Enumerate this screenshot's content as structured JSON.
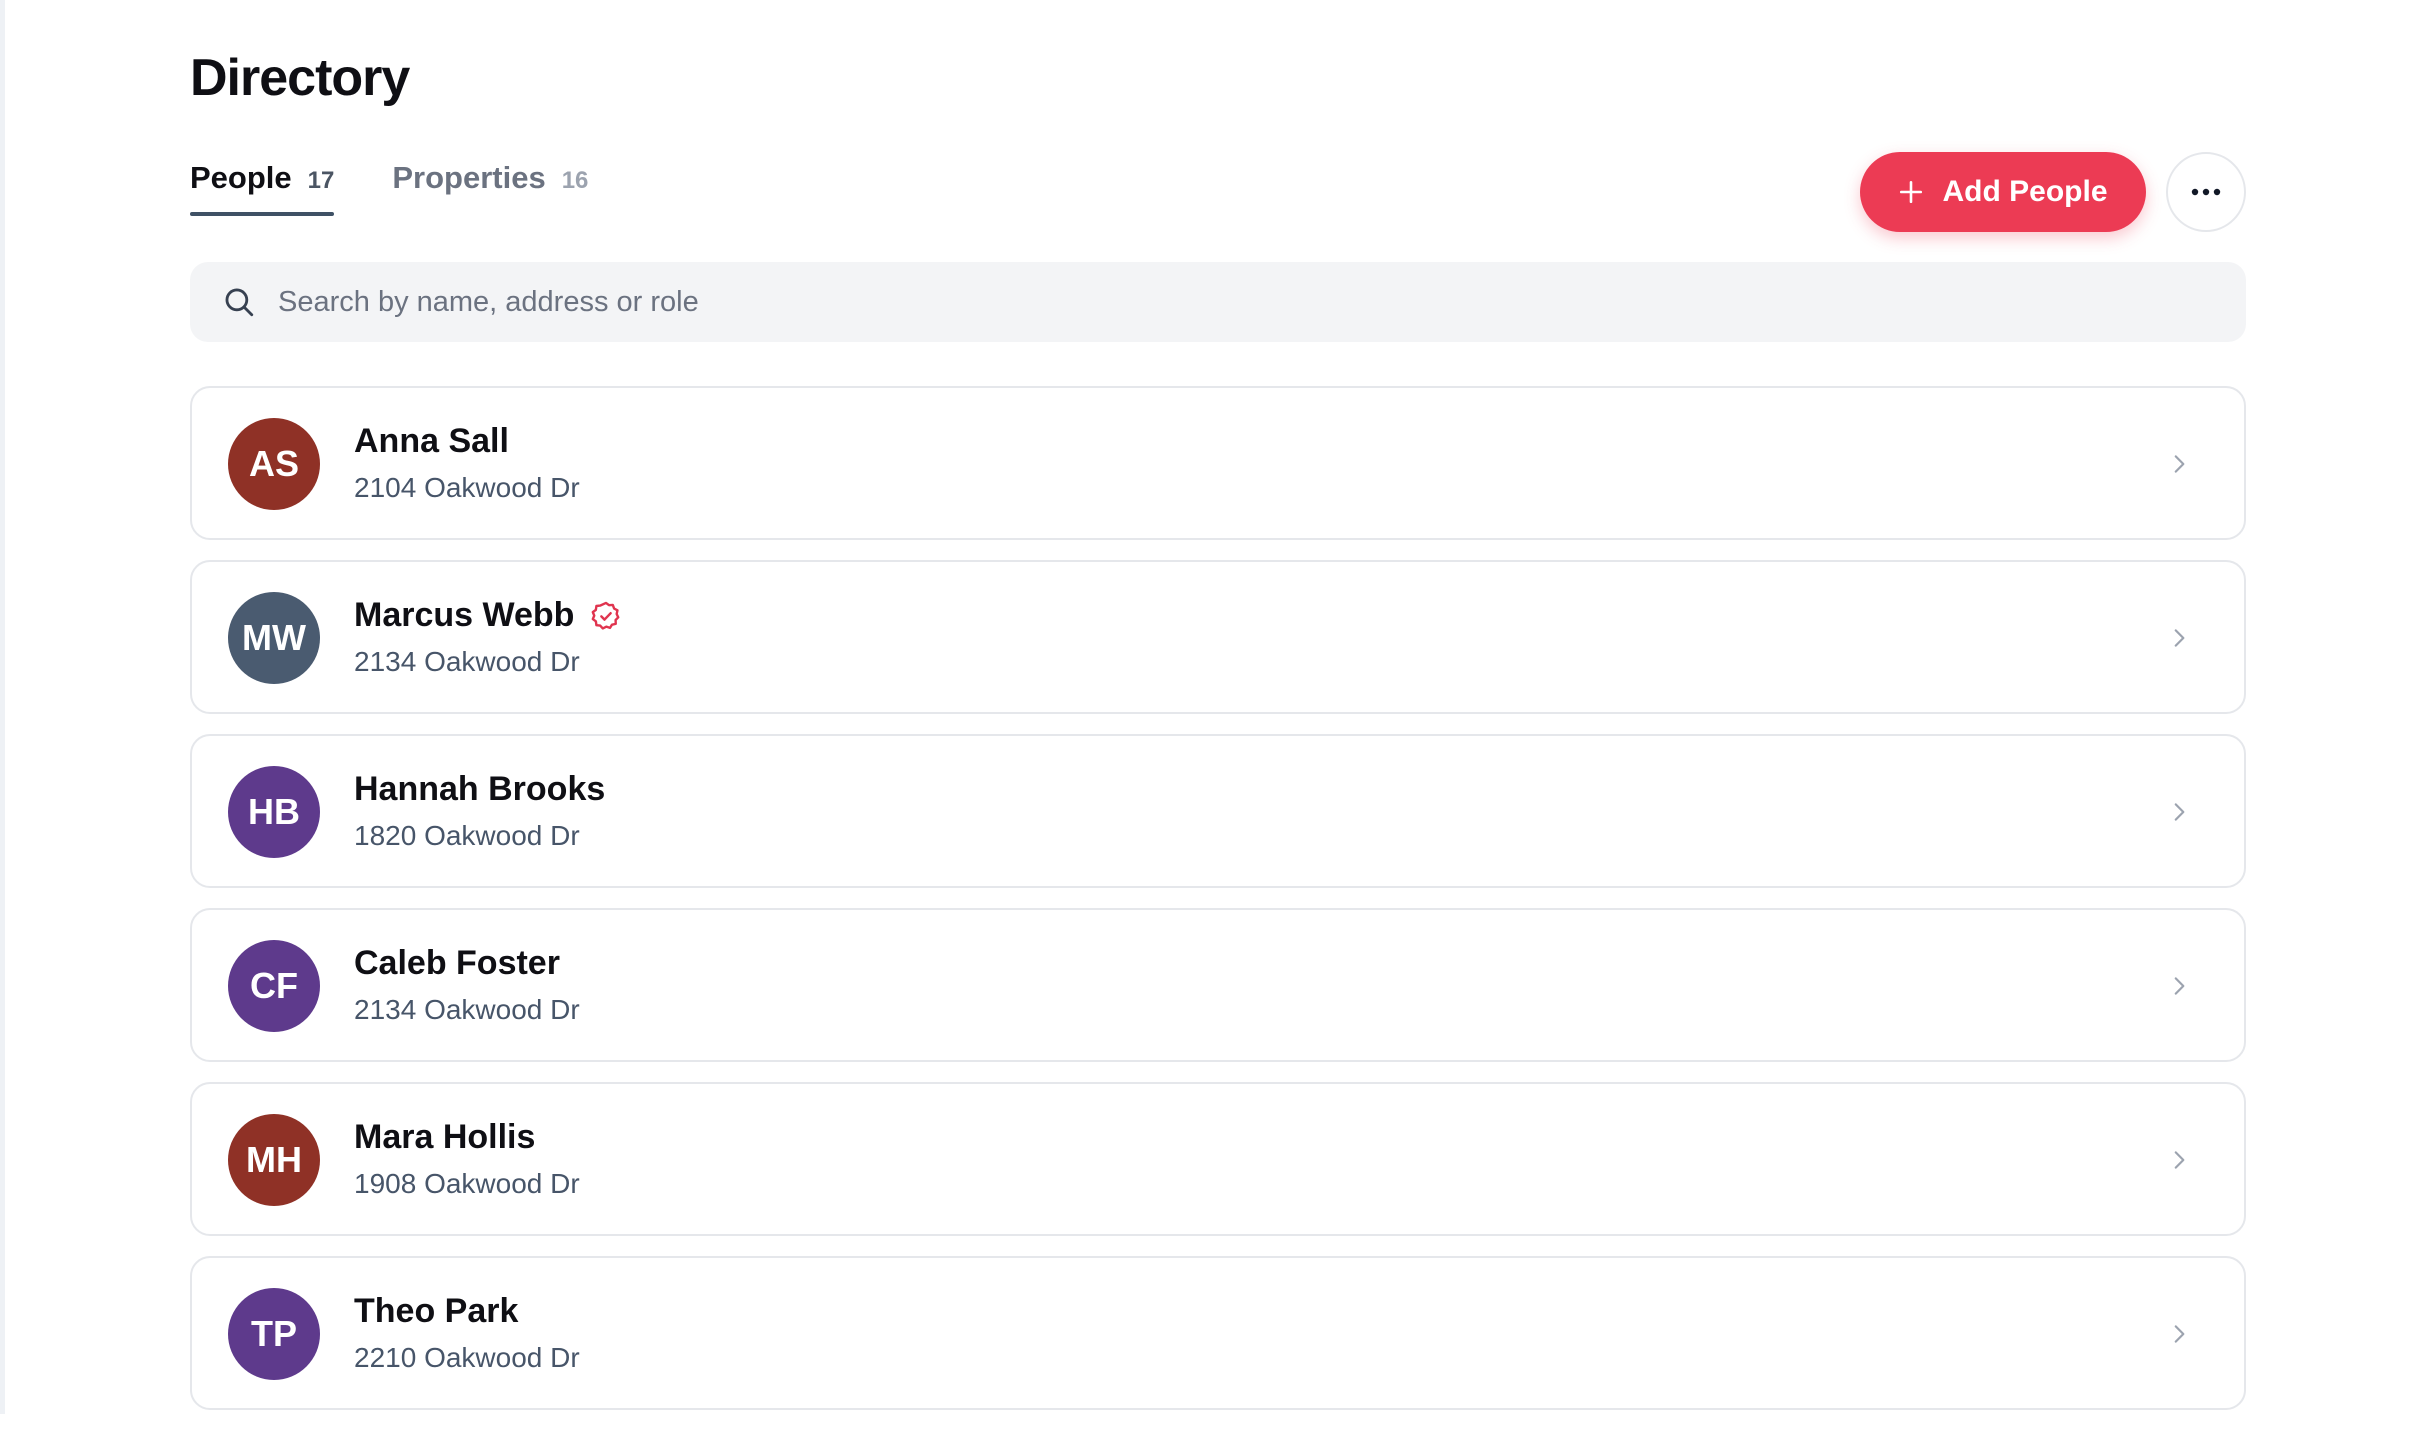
{
  "page": {
    "title": "Directory"
  },
  "tabs": [
    {
      "label": "People",
      "count": "17",
      "active": true
    },
    {
      "label": "Properties",
      "count": "16",
      "active": false
    }
  ],
  "actions": {
    "add_label": "Add People"
  },
  "search": {
    "placeholder": "Search by name, address or role",
    "value": ""
  },
  "people": [
    {
      "initials": "AS",
      "name": "Anna Sall",
      "address": "2104 Oakwood Dr",
      "avatar_color": "#8f3126",
      "verified": false
    },
    {
      "initials": "MW",
      "name": "Marcus Webb",
      "address": "2134 Oakwood Dr",
      "avatar_color": "#4a5b70",
      "verified": true
    },
    {
      "initials": "HB",
      "name": "Hannah Brooks",
      "address": "1820 Oakwood Dr",
      "avatar_color": "#5e3a8c",
      "verified": false
    },
    {
      "initials": "CF",
      "name": "Caleb Foster",
      "address": "2134 Oakwood Dr",
      "avatar_color": "#5e3a8c",
      "verified": false
    },
    {
      "initials": "MH",
      "name": "Mara Hollis",
      "address": "1908 Oakwood Dr",
      "avatar_color": "#8f3126",
      "verified": false
    },
    {
      "initials": "TP",
      "name": "Theo Park",
      "address": "2210 Oakwood Dr",
      "avatar_color": "#5e3a8c",
      "verified": false
    }
  ],
  "colors": {
    "accent": "#ec3b54",
    "tab_underline": "#3f5165",
    "verified_badge": "#e0344f"
  },
  "icons": {
    "add": "plus-icon",
    "more": "more-horizontal-icon",
    "search": "search-icon",
    "verified": "verified-badge-icon",
    "row_action": "chevron-right-icon"
  }
}
